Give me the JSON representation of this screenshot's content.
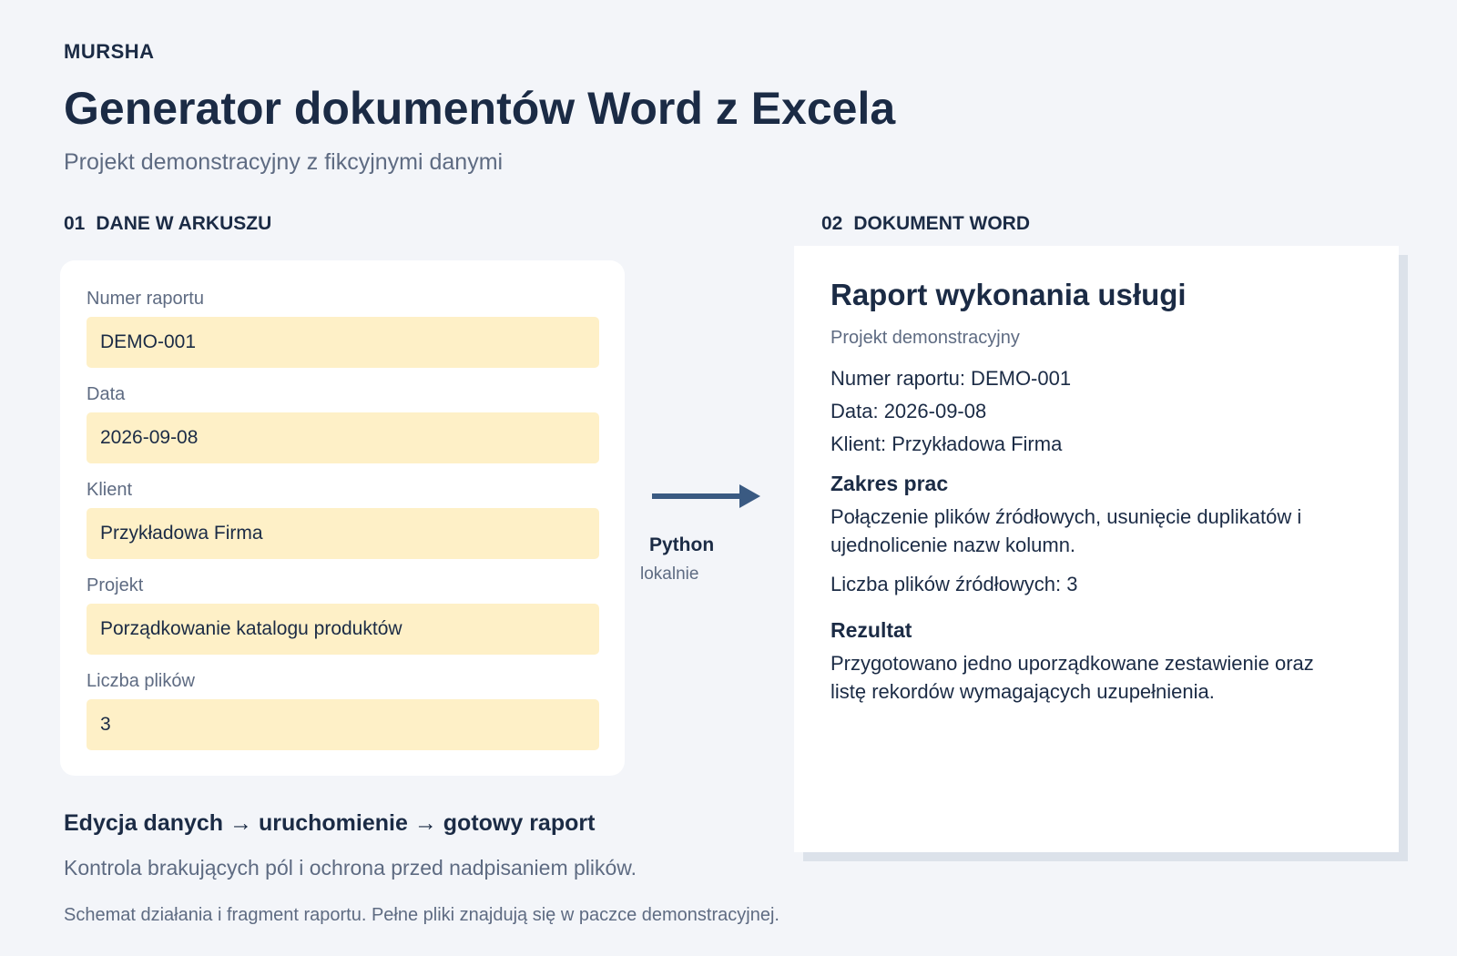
{
  "brand": "MURSHA",
  "title": "Generator dokumentów Word z Excela",
  "subtitle": "Projekt demonstracyjny z fikcyjnymi danymi",
  "sections": {
    "left": {
      "number": "01",
      "label": "DANE W ARKUSZU"
    },
    "right": {
      "number": "02",
      "label": "DOKUMENT WORD"
    }
  },
  "sheet": {
    "fields": [
      {
        "label": "Numer raportu",
        "value": "DEMO-001"
      },
      {
        "label": "Data",
        "value": "2026-09-08"
      },
      {
        "label": "Klient",
        "value": "Przykładowa Firma"
      },
      {
        "label": "Projekt",
        "value": "Porządkowanie katalogu produktów"
      },
      {
        "label": "Liczba plików",
        "value": "3"
      }
    ]
  },
  "arrow": {
    "label": "Python",
    "sub": "lokalnie"
  },
  "document": {
    "title": "Raport wykonania usługi",
    "subtitle": "Projekt demonstracyjny",
    "meta": [
      "Numer raportu: DEMO-001",
      "Data: 2026-09-08",
      "Klient: Przykładowa Firma"
    ],
    "scope_heading": "Zakres prac",
    "scope_text": "Połączenie plików źródłowych, usunięcie duplikatów i ujednolicenie nazw kolumn.",
    "files_count": "Liczba plików źródłowych: 3",
    "result_heading": "Rezultat",
    "result_text": "Przygotowano jedno uporządkowane zestawienie oraz listę rekordów wymagających uzupełnienia."
  },
  "flow": "Edycja danych → uruchomienie → gotowy raport",
  "flow_desc": "Kontrola brakujących pól i ochrona przed nadpisaniem plików.",
  "footnote": "Schemat działania i fragment raportu. Pełne pliki znajdują się w paczce demonstracyjnej.",
  "colors": {
    "background": "#f3f5f9",
    "text": "#1b2b45",
    "muted": "#5e6b82",
    "field_fill": "#fef0c7",
    "arrow": "#3a5a82"
  }
}
